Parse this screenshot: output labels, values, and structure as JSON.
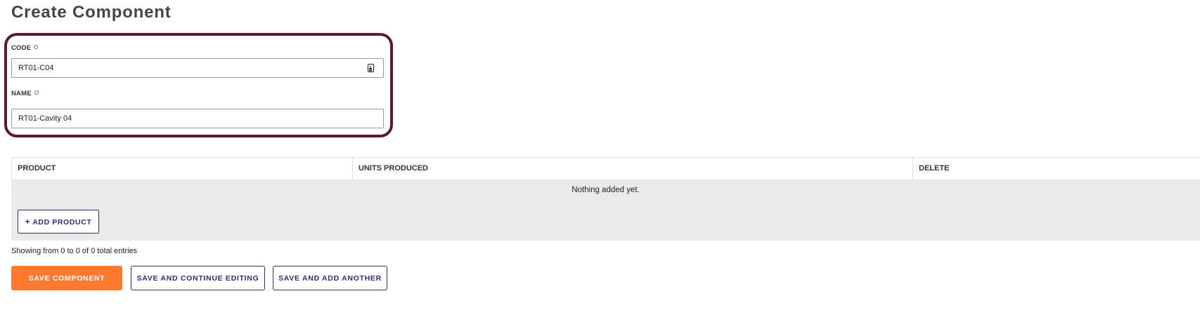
{
  "page": {
    "title": "Create Component"
  },
  "form": {
    "code": {
      "label": "CODE",
      "value": "RT01-C04"
    },
    "name": {
      "label": "NAME",
      "value": "RT01-Cavity 04"
    }
  },
  "table": {
    "columns": [
      "PRODUCT",
      "UNITS PRODUCED",
      "DELETE"
    ],
    "empty_message": "Nothing added yet.",
    "add_button_label": "ADD PRODUCT",
    "add_button_icon": "plus-icon"
  },
  "pagination": {
    "summary": "Showing from 0 to 0 of 0 total entries"
  },
  "actions": {
    "save_label": "SAVE COMPONENT",
    "save_continue_label": "SAVE AND CONTINUE EDITING",
    "save_add_label": "SAVE AND ADD ANOTHER"
  },
  "colors": {
    "highlight_border": "#5a1a33",
    "primary_button": "#ff7a2e",
    "secondary_button_text": "#2e2e7a",
    "table_body_bg": "#ebebeb"
  }
}
